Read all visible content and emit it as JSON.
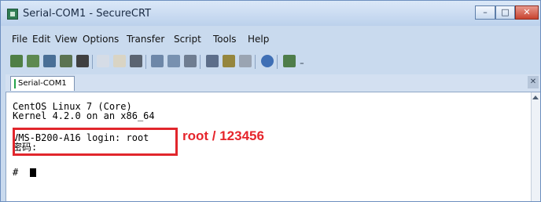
{
  "window": {
    "title": "Serial-COM1 - SecureCRT",
    "controls": {
      "minimize": "–",
      "maximize": "□",
      "close": "✕"
    }
  },
  "menu": [
    "File",
    "Edit",
    "View",
    "Options",
    "Transfer",
    "Script",
    "Tools",
    "Help"
  ],
  "toolbar": {
    "icons": [
      "connect-icon",
      "quick-connect-icon",
      "connect-in-tab-icon",
      "reconnect-icon",
      "disconnect-icon",
      "copy-icon",
      "paste-icon",
      "find-icon",
      "print-icon",
      "print-preview-icon",
      "print-screen-icon",
      "session-options-icon",
      "keymap-icon",
      "help-icon",
      "about-icon",
      "sftp-icon"
    ],
    "overflow": "₌"
  },
  "tab": {
    "label": "Serial-COM1",
    "close": "✕"
  },
  "terminal": {
    "lines": [
      "CentOS Linux 7 (Core)",
      "Kernel 4.2.0 on an x86_64",
      "",
      "VMS-B200-A16 login: root",
      "密码:",
      "",
      "# "
    ]
  },
  "annotation": {
    "text": "root / 123456",
    "color": "#e6252c"
  }
}
